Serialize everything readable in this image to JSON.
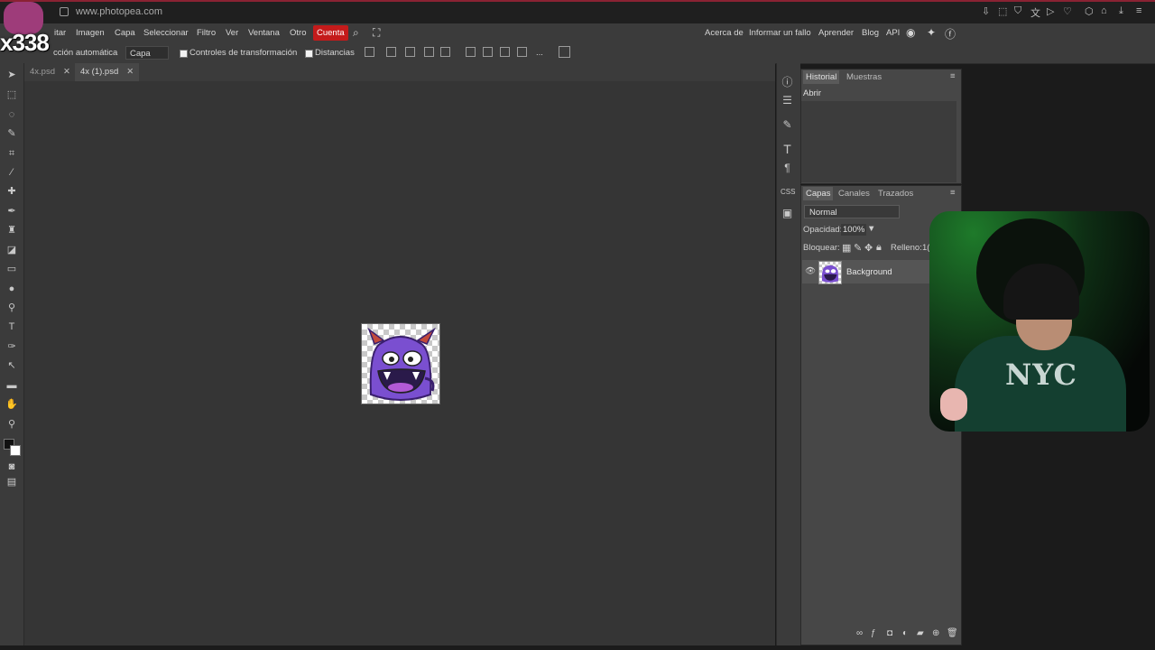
{
  "browser": {
    "url": "www.photopea.com"
  },
  "overlay": {
    "stream_count": "x338"
  },
  "menubar": {
    "items": [
      "itar",
      "Imagen",
      "Capa",
      "Seleccionar",
      "Filtro",
      "Ver",
      "Ventana",
      "Otro"
    ],
    "account": "Cuenta",
    "right_links": [
      "Acerca de",
      "Informar un fallo",
      "Aprender",
      "Blog",
      "API"
    ]
  },
  "options_bar": {
    "auto_select_label": "cción automática",
    "layer_select_value": "Capa",
    "transform_controls_label": "Controles de transformación",
    "distances_label": "Distancias",
    "more_label": "..."
  },
  "tabs": [
    {
      "label": "4x.psd",
      "active": false
    },
    {
      "label": "4x (1).psd",
      "active": true
    }
  ],
  "history_panel": {
    "tabs": [
      "Historial",
      "Muestras"
    ],
    "entries": [
      "Abrir"
    ]
  },
  "layers_panel": {
    "tabs": [
      "Capas",
      "Canales",
      "Trazados"
    ],
    "blend_mode": "Normal",
    "opacity_label": "Opacidad:",
    "opacity_value": "100%",
    "lock_label": "Bloquear:",
    "fill_label": "Relleno:",
    "fill_value": "1(",
    "layers": [
      {
        "name": "Background",
        "visible": true
      }
    ]
  },
  "webcam": {
    "shirt_text": "NYC"
  },
  "colors": {
    "accent_red": "#c41b1b",
    "panel_bg": "#474747",
    "canvas_bg": "#353535"
  }
}
